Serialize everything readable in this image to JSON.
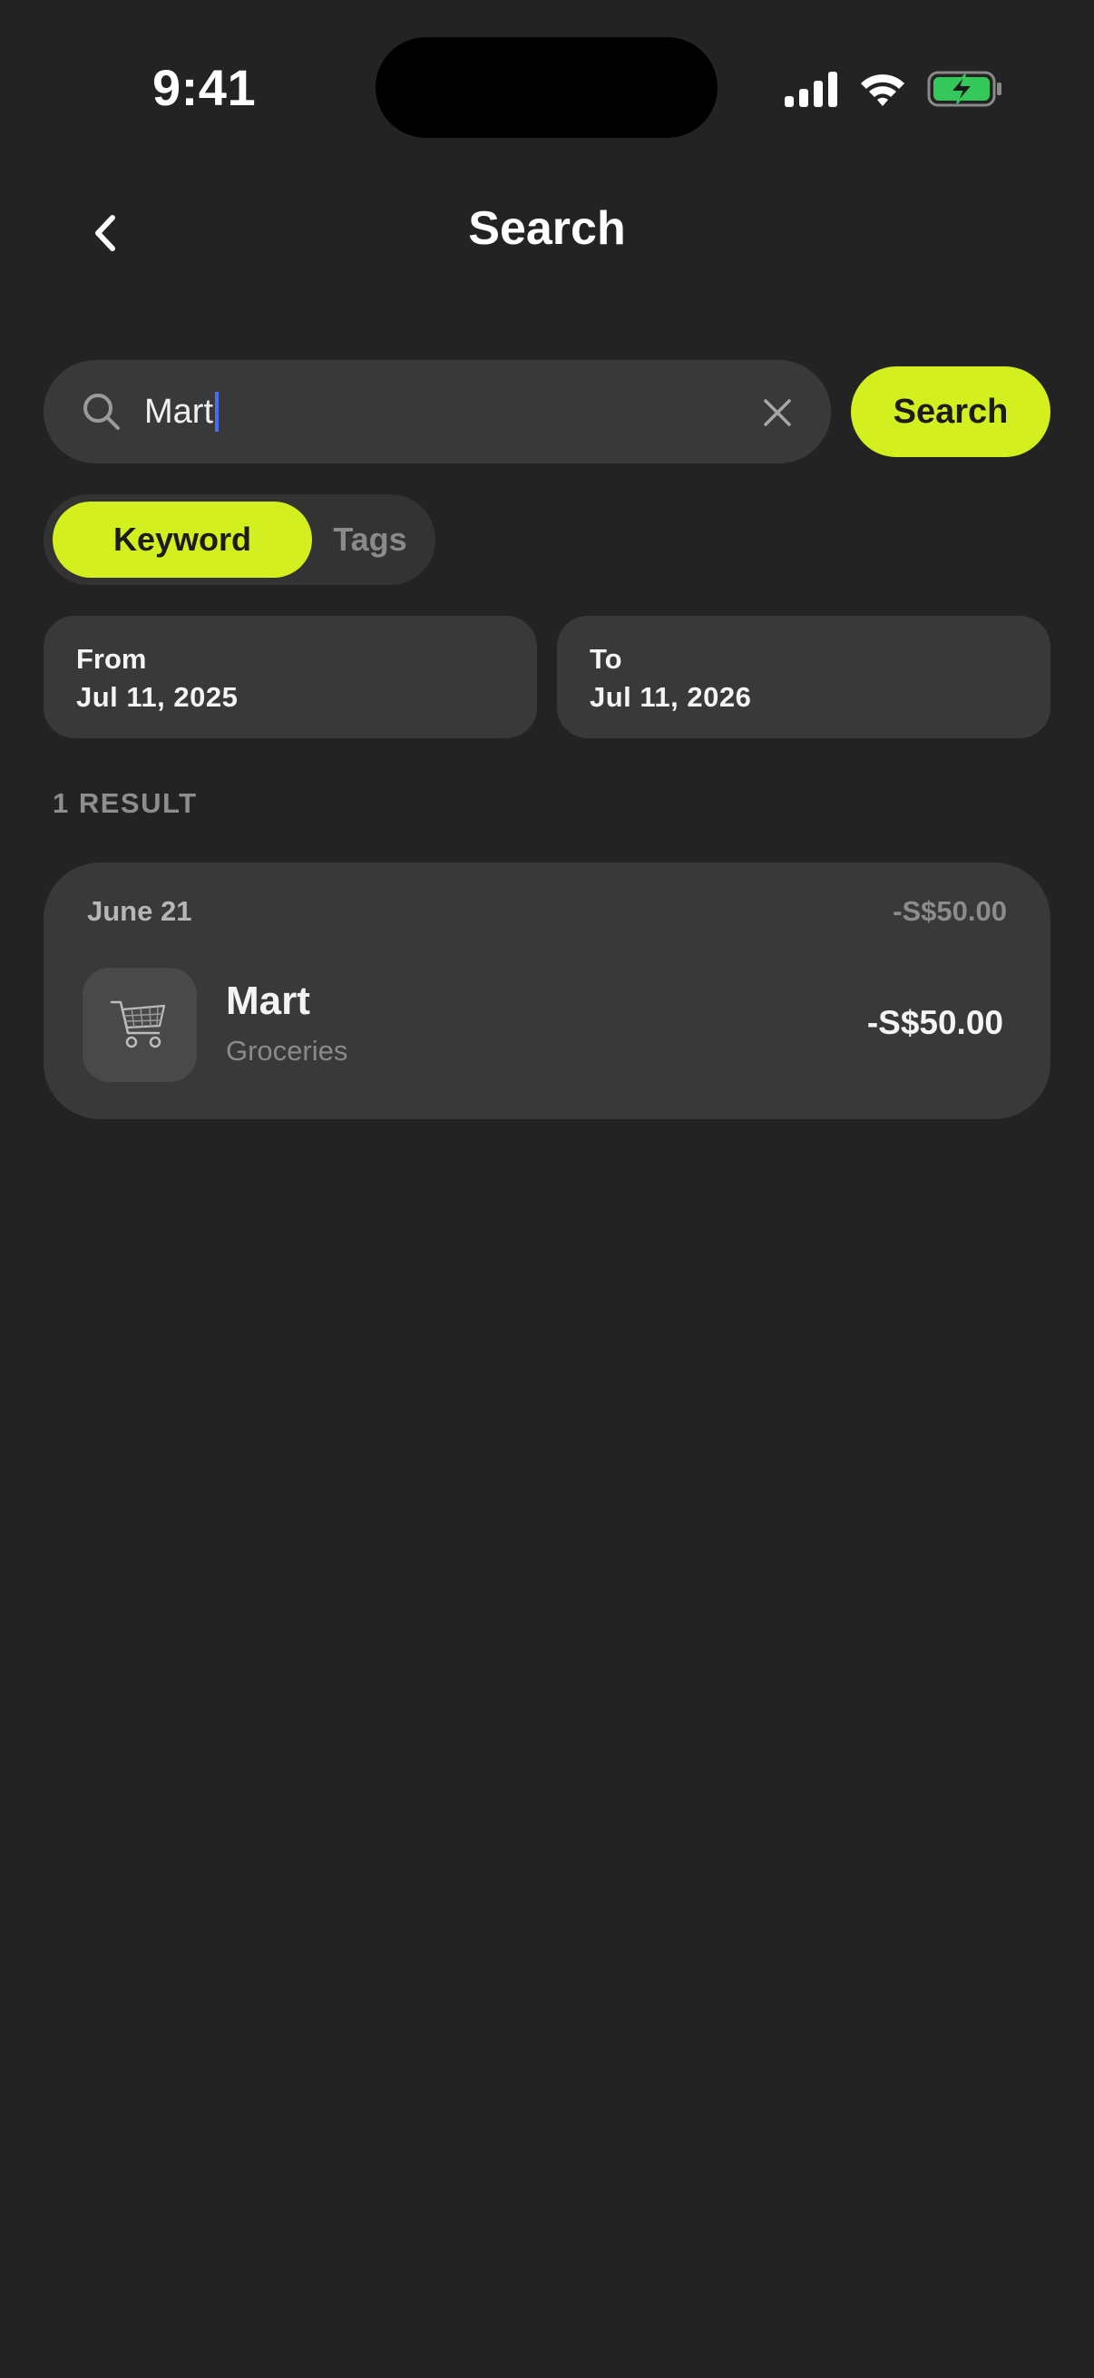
{
  "status_bar": {
    "time": "9:41"
  },
  "nav": {
    "back_icon": "chevron-left-icon",
    "title": "Search"
  },
  "search": {
    "value": "Mart",
    "search_icon": "search-icon",
    "clear_icon": "close-icon",
    "button_label": "Search"
  },
  "mode_toggle": {
    "options": [
      "Keyword",
      "Tags"
    ],
    "selected": "Keyword"
  },
  "date_range": {
    "from": {
      "label": "From",
      "value": "Jul 11, 2025"
    },
    "to": {
      "label": "To",
      "value": "Jul 11, 2026"
    }
  },
  "results": {
    "count_label": "1 RESULT",
    "groups": [
      {
        "date": "June 21",
        "total": "-S$50.00",
        "transactions": [
          {
            "icon": "shopping-cart-icon",
            "name": "Mart",
            "category": "Groceries",
            "amount": "-S$50.00"
          }
        ]
      }
    ]
  },
  "colors": {
    "background": "#232323",
    "surface": "#393939",
    "accent": "#d4ef1f",
    "caret": "#4a6cf7",
    "battery": "#34c759"
  }
}
